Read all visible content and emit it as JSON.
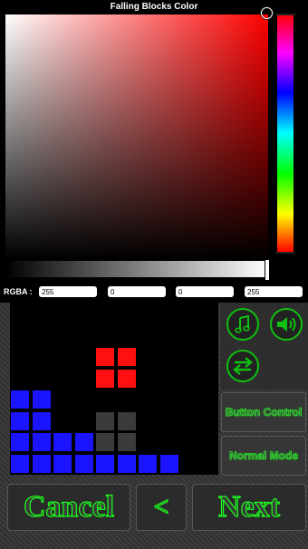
{
  "title": "Falling Blocks Color",
  "rgba": {
    "label": "RGBA :",
    "r": "255",
    "g": "0",
    "b": "0",
    "a": "255"
  },
  "board": {
    "blocks": [
      {
        "color": "red",
        "col": 4,
        "row": 2
      },
      {
        "color": "red",
        "col": 5,
        "row": 2
      },
      {
        "color": "red",
        "col": 4,
        "row": 3
      },
      {
        "color": "red",
        "col": 5,
        "row": 3
      },
      {
        "color": "gray",
        "col": 4,
        "row": 5
      },
      {
        "color": "gray",
        "col": 5,
        "row": 5
      },
      {
        "color": "gray",
        "col": 4,
        "row": 6
      },
      {
        "color": "gray",
        "col": 5,
        "row": 6
      },
      {
        "color": "blue",
        "col": 0,
        "row": 4
      },
      {
        "color": "blue",
        "col": 1,
        "row": 4
      },
      {
        "color": "blue",
        "col": 0,
        "row": 5
      },
      {
        "color": "blue",
        "col": 1,
        "row": 5
      },
      {
        "color": "blue",
        "col": 0,
        "row": 6
      },
      {
        "color": "blue",
        "col": 1,
        "row": 6
      },
      {
        "color": "blue",
        "col": 2,
        "row": 6
      },
      {
        "color": "blue",
        "col": 3,
        "row": 6
      },
      {
        "color": "blue",
        "col": 0,
        "row": 7
      },
      {
        "color": "blue",
        "col": 1,
        "row": 7
      },
      {
        "color": "blue",
        "col": 2,
        "row": 7
      },
      {
        "color": "blue",
        "col": 3,
        "row": 7
      },
      {
        "color": "blue",
        "col": 4,
        "row": 7
      },
      {
        "color": "blue",
        "col": 5,
        "row": 7
      },
      {
        "color": "blue",
        "col": 6,
        "row": 7
      },
      {
        "color": "blue",
        "col": 7,
        "row": 7
      }
    ]
  },
  "icons": {
    "music": "music-note-icon",
    "sound": "speaker-icon",
    "swap": "swap-arrows-icon"
  },
  "buttons": {
    "button_control": "Button Control",
    "normal_mode": "Normal Mode",
    "cancel": "Cancel",
    "back": "<",
    "next": "Next"
  },
  "colors": {
    "accent_green": "#1aff1a",
    "selected_color": "#ff0000"
  }
}
